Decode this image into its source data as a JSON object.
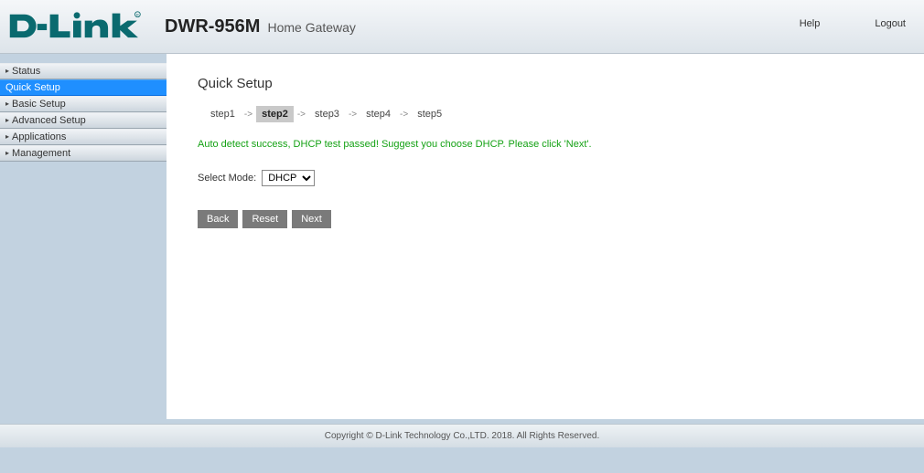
{
  "header": {
    "model": "DWR-956M",
    "subtitle": "Home Gateway",
    "help": "Help",
    "logout": "Logout"
  },
  "sidebar": {
    "items": [
      {
        "label": "Status",
        "active": false
      },
      {
        "label": "Quick Setup",
        "active": true
      },
      {
        "label": "Basic Setup",
        "active": false
      },
      {
        "label": "Advanced Setup",
        "active": false
      },
      {
        "label": "Applications",
        "active": false
      },
      {
        "label": "Management",
        "active": false
      }
    ]
  },
  "main": {
    "title": "Quick Setup",
    "steps": [
      {
        "label": "step1",
        "active": false
      },
      {
        "label": "step2",
        "active": true
      },
      {
        "label": "step3",
        "active": false
      },
      {
        "label": "step4",
        "active": false
      },
      {
        "label": "step5",
        "active": false
      }
    ],
    "status_message": "Auto detect success, DHCP test passed! Suggest you choose DHCP. Please click 'Next'.",
    "select_label": "Select Mode:",
    "select_value": "DHCP",
    "buttons": {
      "back": "Back",
      "reset": "Reset",
      "next": "Next"
    }
  },
  "footer": {
    "text": "Copyright © D-Link Technology Co.,LTD. 2018. All Rights Reserved."
  }
}
